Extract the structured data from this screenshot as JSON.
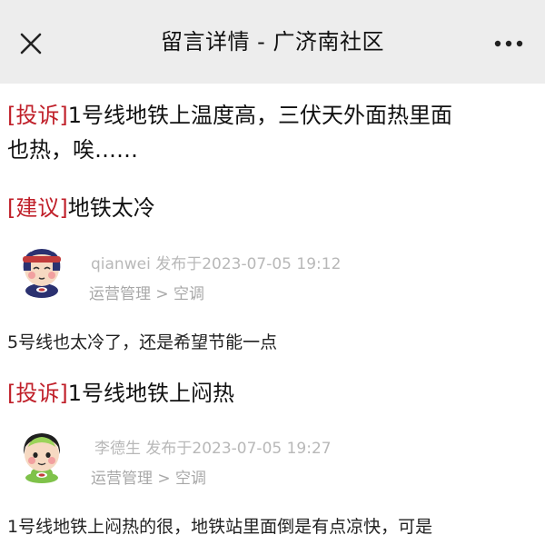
{
  "header": {
    "title": "留言详情 - 广济南社区"
  },
  "posts": [
    {
      "tag": "[投诉]",
      "title_line1": "1号线地铁上温度高，三伏天外面热里面",
      "title_line2": "也热，唉……"
    },
    {
      "tag": "[建议]",
      "title": "地铁太冷",
      "author": "qianwei",
      "posted_prefix": "发布于",
      "posted_at": "2023-07-05 19:12",
      "category": "运营管理 > 空调",
      "body": "5号线也太冷了，还是希望节能一点"
    },
    {
      "tag": "[投诉]",
      "title": "1号线地铁上闷热",
      "author": "李德生",
      "posted_prefix": "发布于",
      "posted_at": "2023-07-05 19:27",
      "category": "运营管理 > 空调",
      "body": "1号线地铁上闷热的很，地铁站里面倒是有点凉快，可是"
    }
  ],
  "colors": {
    "tag": "#c0202a",
    "topbar": "#ededed",
    "meta": "#b8b8b8"
  },
  "icons": {
    "close": "close-icon",
    "more": "more-dots-icon"
  }
}
